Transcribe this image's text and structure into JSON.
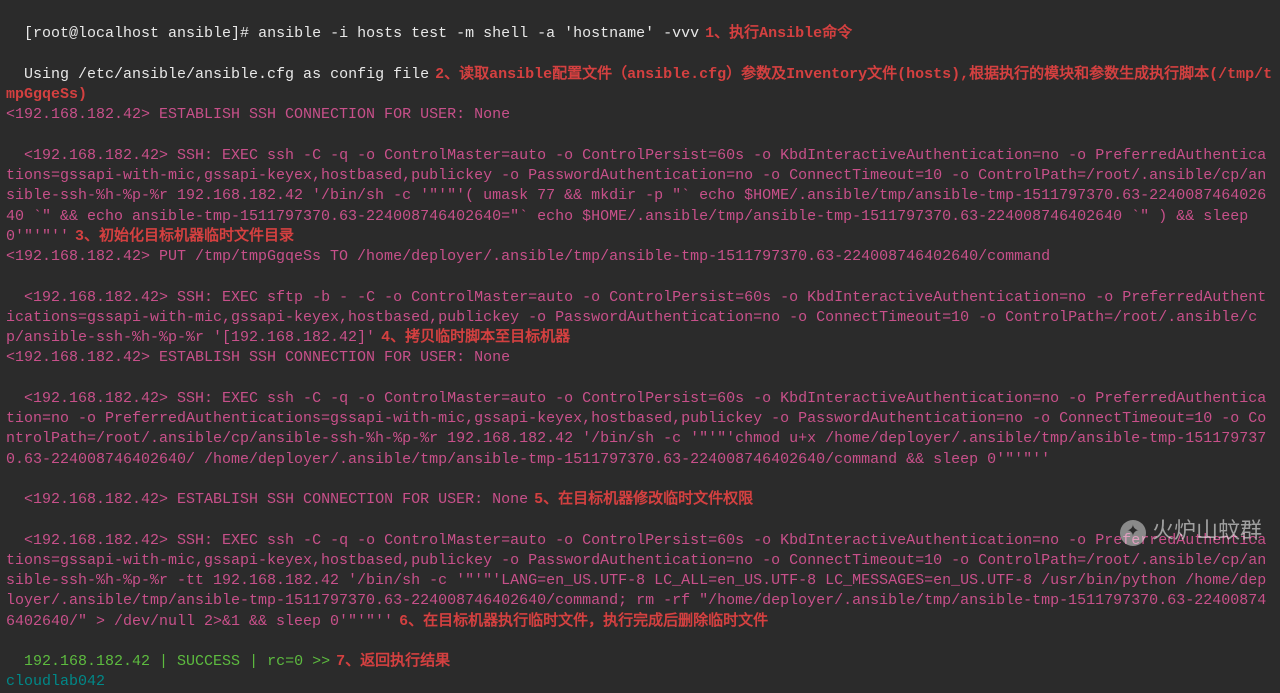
{
  "prompt": "[root@localhost ansible]# ",
  "command": "ansible -i hosts test -m shell -a 'hostname' -vvv",
  "config_line": "Using /etc/ansible/ansible.cfg as config file",
  "annotations": {
    "a1": "1、执行Ansible命令",
    "a2": "2、读取ansible配置文件（ansible.cfg）参数及Inventory文件(hosts),根据执行的模块和参数生成执行脚本(/tmp/tmpGgqeSs)",
    "a3": "3、初始化目标机器临时文件目录",
    "a4": "4、拷贝临时脚本至目标机器",
    "a5": "5、在目标机器修改临时文件权限",
    "a6": "6、在目标机器执行临时文件，执行完成后删除临时文件",
    "a7": "7、返回执行结果"
  },
  "output": {
    "l1": "<192.168.182.42> ESTABLISH SSH CONNECTION FOR USER: None",
    "l2": "<192.168.182.42> SSH: EXEC ssh -C -q -o ControlMaster=auto -o ControlPersist=60s -o KbdInteractiveAuthentication=no -o PreferredAuthentications=gssapi-with-mic,gssapi-keyex,hostbased,publickey -o PasswordAuthentication=no -o ConnectTimeout=10 -o ControlPath=/root/.ansible/cp/ansible-ssh-%h-%p-%r 192.168.182.42 '/bin/sh -c '\"'\"'( umask 77 && mkdir -p \"` echo $HOME/.ansible/tmp/ansible-tmp-1511797370.63-224008746402640 `\" && echo ansible-tmp-1511797370.63-224008746402640=\"` echo $HOME/.ansible/tmp/ansible-tmp-1511797370.63-224008746402640 `\" ) && sleep 0'\"'\"''",
    "l3": "<192.168.182.42> PUT /tmp/tmpGgqeSs TO /home/deployer/.ansible/tmp/ansible-tmp-1511797370.63-224008746402640/command",
    "l4": "<192.168.182.42> SSH: EXEC sftp -b - -C -o ControlMaster=auto -o ControlPersist=60s -o KbdInteractiveAuthentication=no -o PreferredAuthentications=gssapi-with-mic,gssapi-keyex,hostbased,publickey -o PasswordAuthentication=no -o ConnectTimeout=10 -o ControlPath=/root/.ansible/cp/ansible-ssh-%h-%p-%r '[192.168.182.42]'",
    "l5": "<192.168.182.42> ESTABLISH SSH CONNECTION FOR USER: None",
    "l6": "<192.168.182.42> SSH: EXEC ssh -C -q -o ControlMaster=auto -o ControlPersist=60s -o KbdInteractiveAuthentication=no -o PreferredAuthentication=no -o PreferredAuthentications=gssapi-with-mic,gssapi-keyex,hostbased,publickey -o PasswordAuthentication=no -o ConnectTimeout=10 -o ControlPath=/root/.ansible/cp/ansible-ssh-%h-%p-%r 192.168.182.42 '/bin/sh -c '\"'\"'chmod u+x /home/deployer/.ansible/tmp/ansible-tmp-1511797370.63-224008746402640/ /home/deployer/.ansible/tmp/ansible-tmp-1511797370.63-224008746402640/command && sleep 0'\"'\"''",
    "l7": "<192.168.182.42> ESTABLISH SSH CONNECTION FOR USER: None",
    "l8": "<192.168.182.42> SSH: EXEC ssh -C -q -o ControlMaster=auto -o ControlPersist=60s -o KbdInteractiveAuthentication=no -o PreferredAuthentications=gssapi-with-mic,gssapi-keyex,hostbased,publickey -o PasswordAuthentication=no -o ConnectTimeout=10 -o ControlPath=/root/.ansible/cp/ansible-ssh-%h-%p-%r -tt 192.168.182.42 '/bin/sh -c '\"'\"'LANG=en_US.UTF-8 LC_ALL=en_US.UTF-8 LC_MESSAGES=en_US.UTF-8 /usr/bin/python /home/deployer/.ansible/tmp/ansible-tmp-1511797370.63-224008746402640/command; rm -rf \"/home/deployer/.ansible/tmp/ansible-tmp-1511797370.63-224008746402640/\" > /dev/null 2>&1 && sleep 0'\"'\"''"
  },
  "result": {
    "host": "192.168.182.42",
    "status": " | SUCCESS | rc=0 >>",
    "hostname": "cloudlab042"
  },
  "watermark": "火炉山蚊群"
}
